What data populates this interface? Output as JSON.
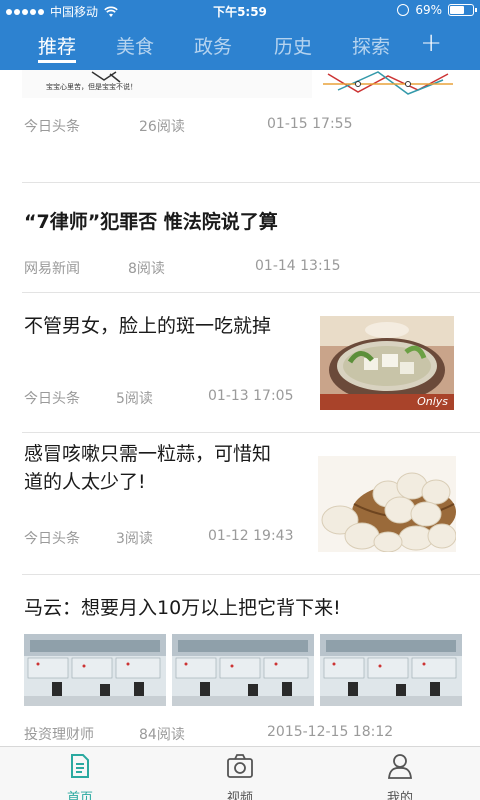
{
  "status": {
    "carrier": "中国移动",
    "time": "下午5:59",
    "battery": "69%",
    "battery_level": 0.69
  },
  "nav": {
    "tabs": [
      {
        "label": "推荐",
        "active": true
      },
      {
        "label": "美食",
        "active": false
      },
      {
        "label": "政务",
        "active": false
      },
      {
        "label": "历史",
        "active": false
      },
      {
        "label": "探索",
        "active": false
      }
    ],
    "add_label": "+"
  },
  "feed": {
    "items": [
      {
        "source": "今日头条",
        "reads": "26阅读",
        "time": "01-15 17:55",
        "partial_caption": "宝宝心里苦，但是宝宝不说！"
      },
      {
        "title": "“7律师”犯罪否 惟法院说了算",
        "source": "网易新闻",
        "reads": "8阅读",
        "time": "01-14 13:15"
      },
      {
        "title": "不管男女，脸上的斑一吃就掉",
        "source": "今日头条",
        "reads": "5阅读",
        "time": "01-13 17:05",
        "thumb_caption": "Onlys"
      },
      {
        "title_line1": "感冒咳嗽只需一粒蒜，可惜知",
        "title_line2": "道的人太少了!",
        "source": "今日头条",
        "reads": "3阅读",
        "time": "01-12 19:43"
      },
      {
        "title": "马云：想要月入10万以上把它背下来!",
        "source": "投资理财师",
        "reads": "84阅读",
        "time": "2015-12-15 18:12"
      }
    ]
  },
  "tabbar": {
    "items": [
      {
        "label": "首页",
        "active": true
      },
      {
        "label": "视频",
        "active": false
      },
      {
        "label": "我的",
        "active": false
      }
    ]
  },
  "colors": {
    "header": "#2d82d0",
    "active_tab": "#2aa9a0"
  }
}
